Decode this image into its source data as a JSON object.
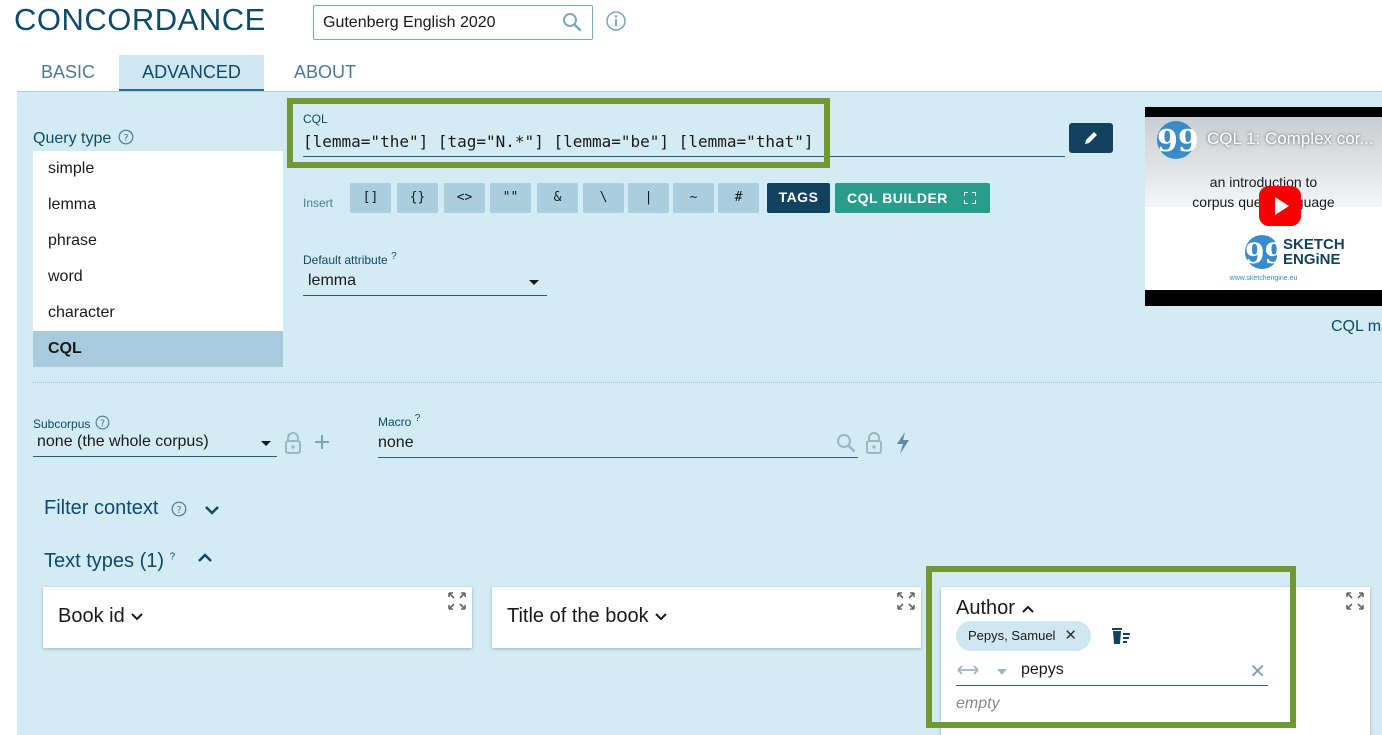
{
  "app": {
    "title": "CONCORDANCE"
  },
  "corpus": {
    "name": "Gutenberg English 2020"
  },
  "tabs": [
    {
      "label": "BASIC",
      "active": false
    },
    {
      "label": "ADVANCED",
      "active": true
    },
    {
      "label": "ABOUT",
      "active": false
    }
  ],
  "query_type": {
    "label": "Query type",
    "items": [
      {
        "label": "simple"
      },
      {
        "label": "lemma"
      },
      {
        "label": "phrase"
      },
      {
        "label": "word"
      },
      {
        "label": "character"
      },
      {
        "label": "CQL",
        "selected": true
      }
    ]
  },
  "cql": {
    "label": "CQL",
    "value": "[lemma=\"the\"] [tag=\"N.*\"] [lemma=\"be\"] [lemma=\"that\"]",
    "insert_label": "Insert",
    "insert_buttons": [
      "[]",
      "{}",
      "<>",
      "\"\"",
      "&",
      "\\",
      "|",
      "~",
      "#"
    ],
    "tags_label": "TAGS",
    "builder_label": "CQL BUILDER"
  },
  "default_attribute": {
    "label": "Default attribute",
    "sup": "?",
    "value": "lemma"
  },
  "video": {
    "title": "CQL 1: Complex cor...",
    "intro_line1": "an introduction to",
    "intro_line2": "corpus query language",
    "brand_line1": "SKETCH",
    "brand_line2": "ENGiNE",
    "site": "www.sketchengine.eu"
  },
  "cql_manual": "CQL manual",
  "subcorpus": {
    "label": "Subcorpus",
    "value": "none (the whole corpus)"
  },
  "macro": {
    "label": "Macro",
    "sup": "?",
    "value": "none"
  },
  "filter_context": {
    "label": "Filter context"
  },
  "text_types": {
    "label": "Text types (1)",
    "sup": "?",
    "cards": [
      {
        "title": "Book id"
      },
      {
        "title": "Title of the book"
      }
    ],
    "author": {
      "title": "Author",
      "chip": "Pepys, Samuel",
      "search_value": "pepys",
      "empty_text": "empty"
    }
  },
  "colors": {
    "panel_bg": "#d3ebf3",
    "primary_dark": "#11425e",
    "builder_teal": "#2a9c8c",
    "highlight_green": "#6f9a33",
    "title_blue": "#0e4a6b"
  },
  "icons": {
    "corpus_search": "search-icon",
    "info": "info-icon",
    "edit": "pencil-icon",
    "expand": "expand-icon",
    "lock": "lock-icon",
    "plus": "plus-icon",
    "bolt": "bolt-icon",
    "trash": "trash-icon",
    "clear": "close-icon"
  }
}
